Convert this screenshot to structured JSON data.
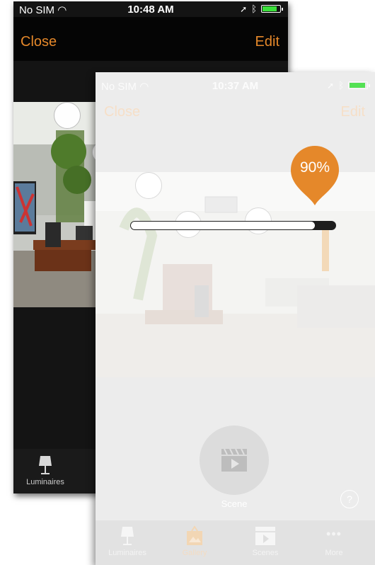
{
  "back_screen": {
    "status": {
      "carrier": "No SIM",
      "time": "10:48 AM"
    },
    "nav": {
      "close_label": "Close",
      "edit_label": "Edit"
    },
    "tab": {
      "luminaires_label": "Luminaires"
    }
  },
  "front_screen": {
    "status": {
      "carrier": "No SIM",
      "time": "10:37 AM"
    },
    "nav": {
      "close_label": "Close",
      "edit_label": "Edit"
    },
    "dimmer": {
      "value_label": "90%",
      "level": 0.9
    },
    "scene_button": {
      "label": "Scene"
    },
    "help_icon": "question-icon",
    "tabs": [
      {
        "label": "Luminaires",
        "icon": "lamp-icon"
      },
      {
        "label": "Gallery",
        "icon": "gallery-icon"
      },
      {
        "label": "Scenes",
        "icon": "clapperboard-icon"
      },
      {
        "label": "More",
        "icon": "more-icon"
      }
    ]
  },
  "colors": {
    "accent": "#e5882a",
    "badge": "#e5882a",
    "battery": "#3ae03a"
  }
}
